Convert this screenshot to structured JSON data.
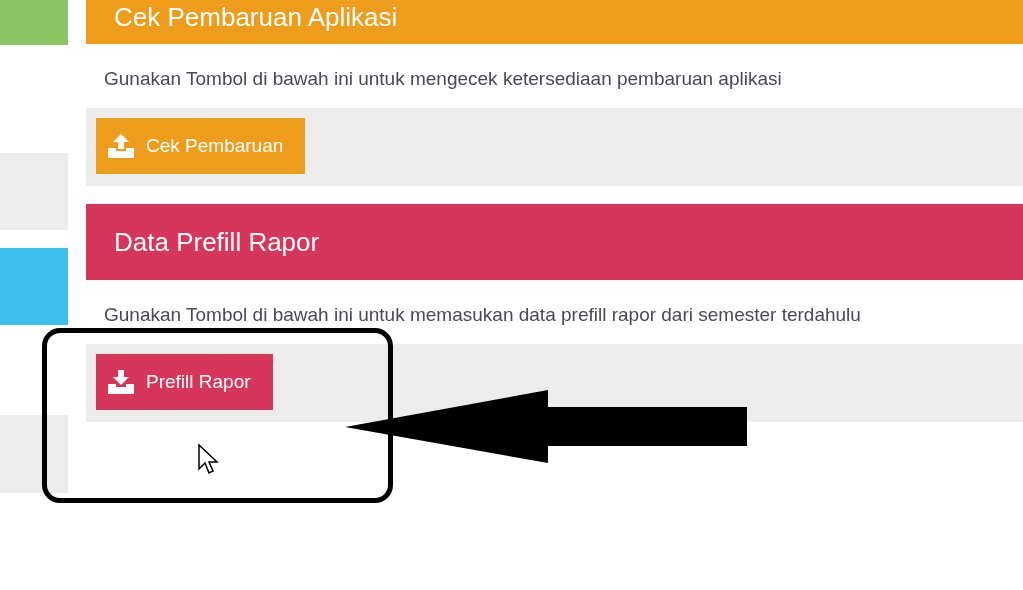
{
  "sidebar": {
    "tiles": [
      {
        "color": "#8cc464"
      },
      {
        "color": "#ececec"
      },
      {
        "color": "#3cc0ee"
      },
      {
        "color": "#ececec"
      }
    ]
  },
  "sections": [
    {
      "title": "Cek Pembaruan Aplikasi",
      "color": "#ee9c1b",
      "description": "Gunakan Tombol di bawah ini untuk mengecek ketersediaan pembaruan aplikasi",
      "button": {
        "label": "Cek Pembaruan",
        "kind": "upload"
      }
    },
    {
      "title": "Data Prefill Rapor",
      "color": "#d6365a",
      "description": "Gunakan Tombol di bawah ini untuk memasukan data prefill rapor dari semester terdahulu",
      "button": {
        "label": "Prefill Rapor",
        "kind": "download"
      }
    }
  ]
}
